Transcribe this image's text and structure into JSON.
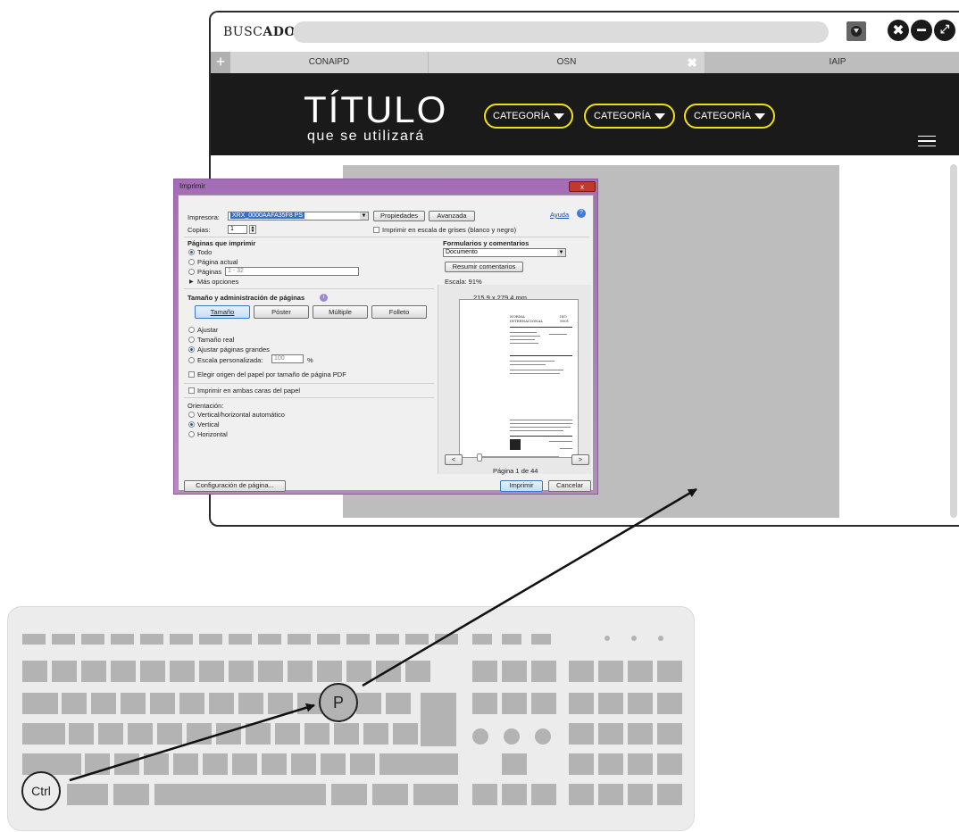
{
  "browser": {
    "brand_prefix": "BUSC",
    "brand_suffix": "ADOR",
    "tabs": [
      "CONAIPD",
      "OSN",
      "IAIP"
    ],
    "tab_add": "+",
    "tab_close": "✖",
    "window_buttons": [
      "✖",
      "━",
      "⤢"
    ]
  },
  "site": {
    "title": "TÍTULO",
    "subtitle": "que se utilizará",
    "categories": [
      "CATEGORÍA",
      "CATEGORÍA",
      "CATEGORÍA"
    ]
  },
  "print_dialog": {
    "window_title": "Imprimir",
    "close": "x",
    "help": "Ayuda",
    "printer_label": "Impresora:",
    "printer_value": "XRX_0000AAFA35F8 PS",
    "properties": "Propiedades",
    "advanced": "Avanzada",
    "copies_label": "Copias:",
    "copies_value": "1",
    "grayscale": "Imprimir en escala de grises (blanco y negro)",
    "pages_heading": "Páginas que imprimir",
    "pages_all": "Todo",
    "pages_current": "Página actual",
    "pages_range": "Páginas",
    "pages_range_value": "1 - 32",
    "more_options": "Más opciones",
    "forms_heading": "Formularios y comentarios",
    "forms_value": "Documento",
    "summarize": "Resumir comentarios",
    "scale": "Escala: 91%",
    "size_heading": "Tamaño y administración de páginas",
    "size_buttons": [
      "Tamaño",
      "Póster",
      "Múltiple",
      "Folleto"
    ],
    "fit": "Ajustar",
    "actual_size": "Tamaño real",
    "shrink": "Ajustar páginas grandes",
    "custom_scale": "Escala personalizada:",
    "custom_scale_value": "100",
    "percent": "%",
    "paper_source": "Elegir origen del papel por tamaño de página PDF",
    "duplex": "Imprimir en ambas caras del papel",
    "orientation_label": "Orientación:",
    "orient_auto": "Vertical/horizontal automático",
    "orient_portrait": "Vertical",
    "orient_landscape": "Horizontal",
    "paper_size": "215.9 x 279.4 mm",
    "page_indicator": "Página 1 de 44",
    "prev": "<",
    "next": ">",
    "page_setup": "Configuración de página...",
    "print": "Imprimir",
    "cancel": "Cancelar",
    "preview_doc": {
      "heading_left": "NORMA",
      "heading_left2": "INTERNACIONAL",
      "heading_right": "ISO",
      "heading_right2": "9001"
    }
  },
  "keyboard": {
    "key_p": "P",
    "key_ctrl": "Ctrl"
  }
}
